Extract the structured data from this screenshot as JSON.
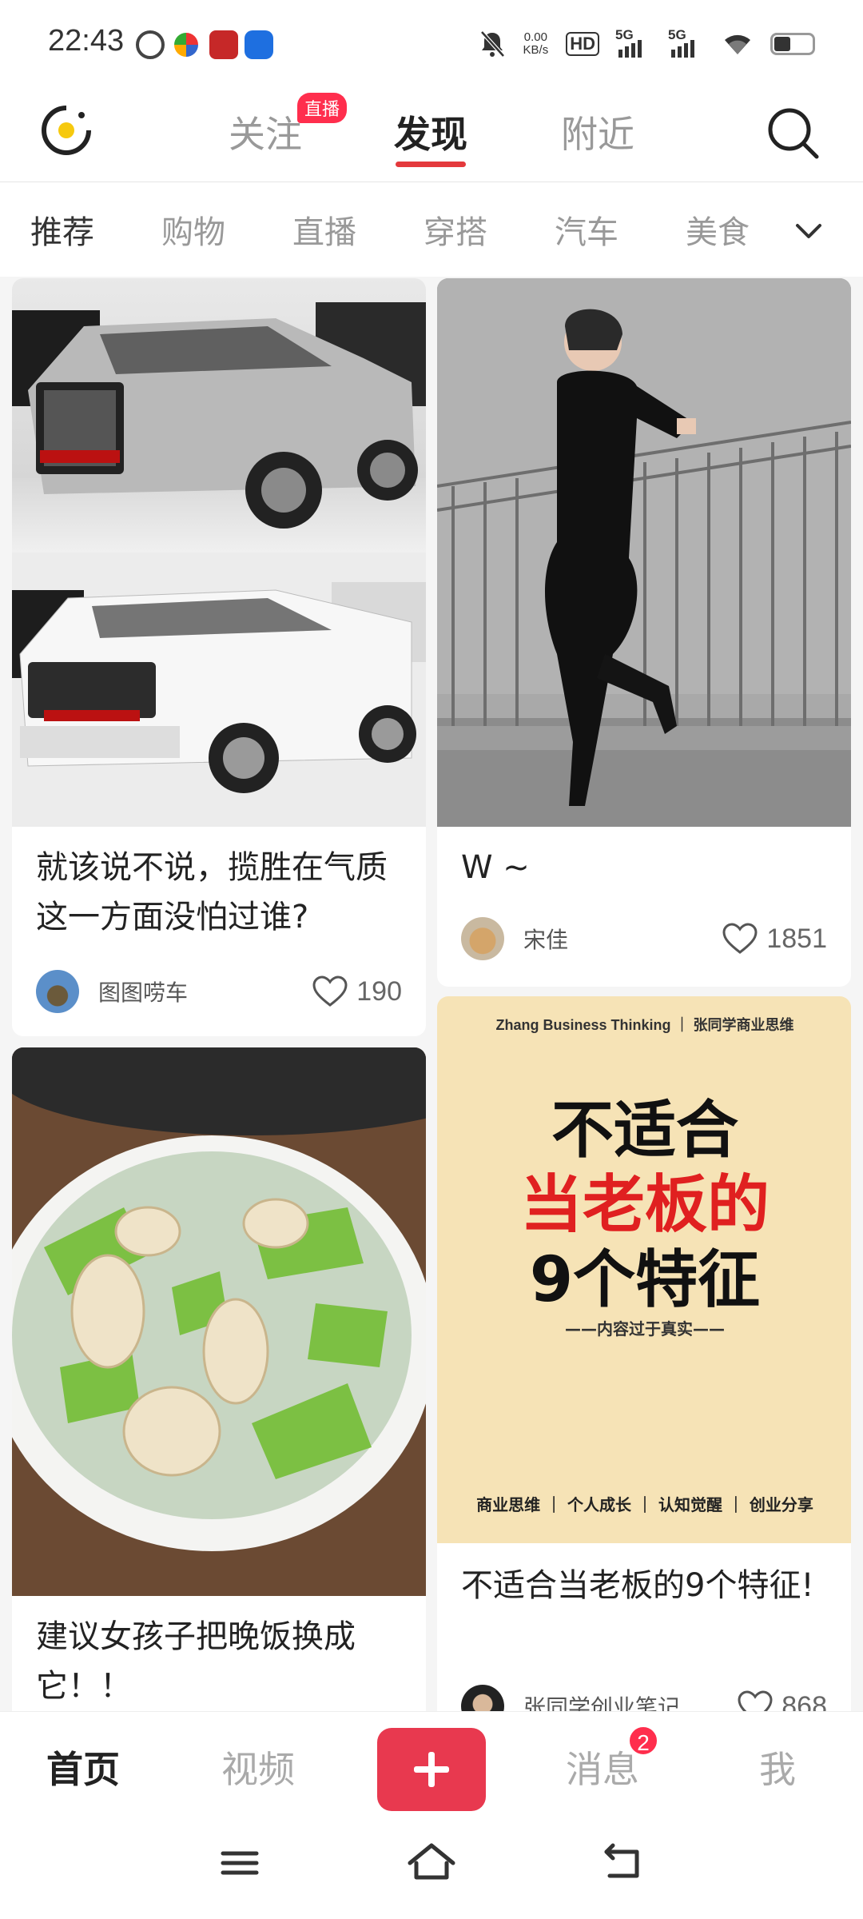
{
  "status_bar": {
    "time": "22:43",
    "net_speed_value": "0.00",
    "net_speed_unit": "KB/s",
    "hd_label": "HD",
    "signal1_label": "5G",
    "signal2_label": "5G",
    "icons": [
      "app-notification-icon",
      "app-notification-icon",
      "app-notification-icon",
      "app-notification-icon",
      "mute-icon",
      "wifi-icon",
      "battery-icon"
    ]
  },
  "top_nav": {
    "tabs": [
      {
        "label": "关注"
      },
      {
        "label": "发现"
      },
      {
        "label": "附近"
      }
    ],
    "active_tab": "发现",
    "live_badge": "直播"
  },
  "categories": {
    "items": [
      "推荐",
      "购物",
      "直播",
      "穿搭",
      "汽车",
      "美食"
    ],
    "active": "推荐"
  },
  "feed": {
    "cards": [
      {
        "title": "就该说不说，揽胜在气质这一方面没怕过谁?",
        "author": "图图唠车",
        "likes": "190",
        "image": "luxury-suvs-photo"
      },
      {
        "title": "W ~",
        "author": "宋佳",
        "likes": "1851",
        "image": "woman-black-dress-photo"
      },
      {
        "title": "建议女孩子把晚饭换成它！！",
        "author": "",
        "likes": "",
        "image": "clam-soup-photo"
      },
      {
        "title": "不适合当老板的9个特征!",
        "author": "张同学创业笔记",
        "likes": "868",
        "image": "poster"
      }
    ],
    "poster": {
      "header": "Zhang Business Thinking ｜ 张同学商业思维",
      "line1": "不适合",
      "line2": "当老板的",
      "line3": "9个特征",
      "sub": "——内容过于真实——",
      "footer": "商业思维 ｜ 个人成长 ｜ 认知觉醒 ｜ 创业分享"
    }
  },
  "bottom_nav": {
    "home": "首页",
    "video": "视频",
    "messages": "消息",
    "me": "我",
    "message_badge": "2",
    "accent_color": "#e8394f"
  }
}
